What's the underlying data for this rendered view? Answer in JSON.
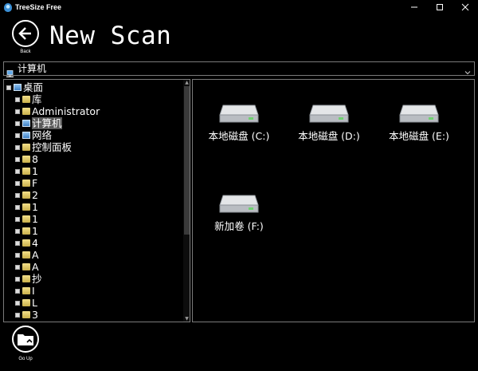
{
  "window": {
    "title": "TreeSize Free"
  },
  "header": {
    "back_label": "Back",
    "title": "New Scan"
  },
  "address": {
    "path": "计算机"
  },
  "tree": {
    "items": [
      {
        "label": "桌面",
        "icon": "desktop-icon"
      },
      {
        "label": "库",
        "icon": "library-icon"
      },
      {
        "label": "Administrator",
        "icon": "user-folder-icon"
      },
      {
        "label": "计算机",
        "icon": "computer-icon",
        "selected": true
      },
      {
        "label": "网络",
        "icon": "network-icon"
      },
      {
        "label": "控制面板",
        "icon": "control-panel-icon"
      },
      {
        "label": "8",
        "icon": "folder-icon"
      },
      {
        "label": "1",
        "icon": "folder-icon"
      },
      {
        "label": "F",
        "icon": "folder-icon"
      },
      {
        "label": "2",
        "icon": "folder-icon"
      },
      {
        "label": "1",
        "icon": "folder-icon"
      },
      {
        "label": "1",
        "icon": "folder-icon"
      },
      {
        "label": "1",
        "icon": "folder-icon"
      },
      {
        "label": "4",
        "icon": "folder-icon"
      },
      {
        "label": "A",
        "icon": "folder-icon"
      },
      {
        "label": "A",
        "icon": "folder-icon"
      },
      {
        "label": "抄",
        "icon": "folder-icon"
      },
      {
        "label": "I",
        "icon": "folder-icon"
      },
      {
        "label": "L",
        "icon": "folder-icon"
      },
      {
        "label": "3",
        "icon": "folder-icon"
      }
    ]
  },
  "drives": [
    {
      "label": "本地磁盘 (C:)"
    },
    {
      "label": "本地磁盘 (D:)"
    },
    {
      "label": "本地磁盘 (E:)"
    },
    {
      "label": "新加卷 (F:)"
    }
  ],
  "footer": {
    "goup_label": "Go Up"
  },
  "colors": {
    "background": "#000000",
    "border": "#7a7a7a",
    "selection": "#5a5a5a"
  }
}
